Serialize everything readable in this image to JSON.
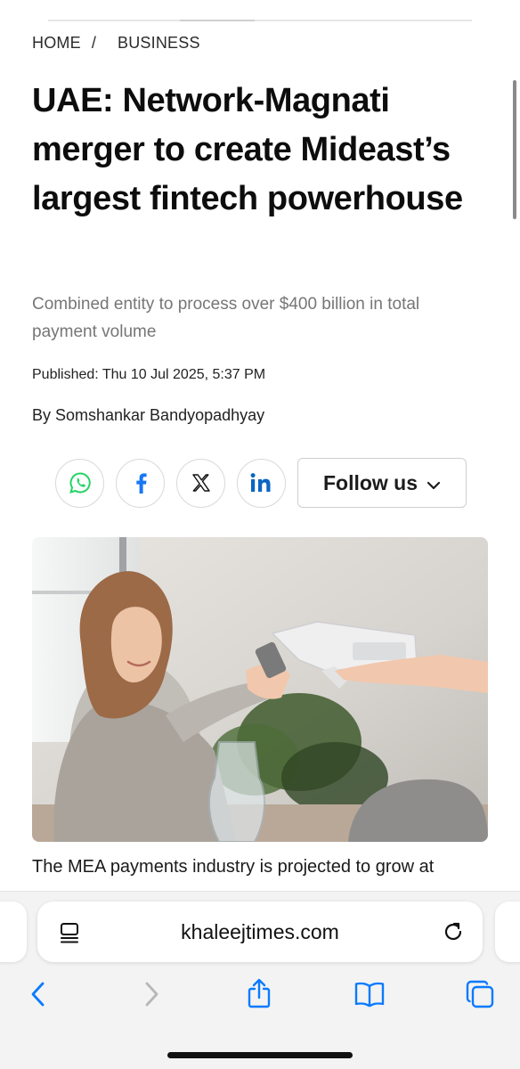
{
  "breadcrumb": {
    "home": "HOME",
    "separator": "/",
    "section": "BUSINESS"
  },
  "article": {
    "headline": "UAE: Network-Magnati merger to create Mideast’s largest fintech powerhouse",
    "subheadline": "Combined entity to process over $400 billion in total payment volume",
    "published": "Published: Thu 10 Jul 2025, 5:37 PM",
    "byline": "By Somshankar Bandyopadhyay",
    "body_first_line": "The MEA payments industry is projected to grow at",
    "hero_image": "woman-paying-with-phone-at-card-terminal"
  },
  "share": {
    "buttons": [
      {
        "name": "whatsapp",
        "icon": "whatsapp-icon",
        "color": "#25D366"
      },
      {
        "name": "facebook",
        "icon": "facebook-icon",
        "color": "#1877F2"
      },
      {
        "name": "x",
        "icon": "x-icon",
        "color": "#111111"
      },
      {
        "name": "linkedin",
        "icon": "linkedin-icon",
        "color": "#0A66C2"
      }
    ],
    "follow_label": "Follow us"
  },
  "browser": {
    "url": "khaleejtimes.com",
    "accent": "#0A7AFF",
    "toolbar": [
      "back-icon",
      "forward-icon",
      "share-icon",
      "bookmarks-icon",
      "tabs-icon"
    ]
  }
}
